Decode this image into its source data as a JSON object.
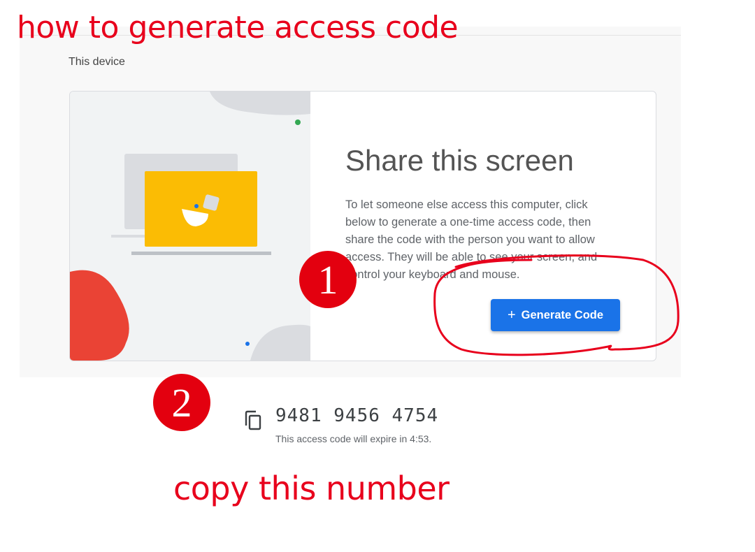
{
  "annotations": {
    "title": "how to generate access code",
    "copy_note": "copy this number",
    "step1": "1",
    "step2": "2",
    "accent_color": "#e8001c"
  },
  "section": {
    "label": "This device"
  },
  "share_card": {
    "title": "Share this screen",
    "description": "To let someone else access this computer, click below to generate a one-time access code, then share the code with the person you want to allow access. They will be able to see your screen, and control your keyboard and mouse.",
    "button_icon": "+",
    "button_label": "Generate Code",
    "button_color": "#1a73e8"
  },
  "access_code": {
    "icon": "copy-icon",
    "code": "9481 9456 4754",
    "expiry_text": "This access code will expire in 4:53."
  }
}
